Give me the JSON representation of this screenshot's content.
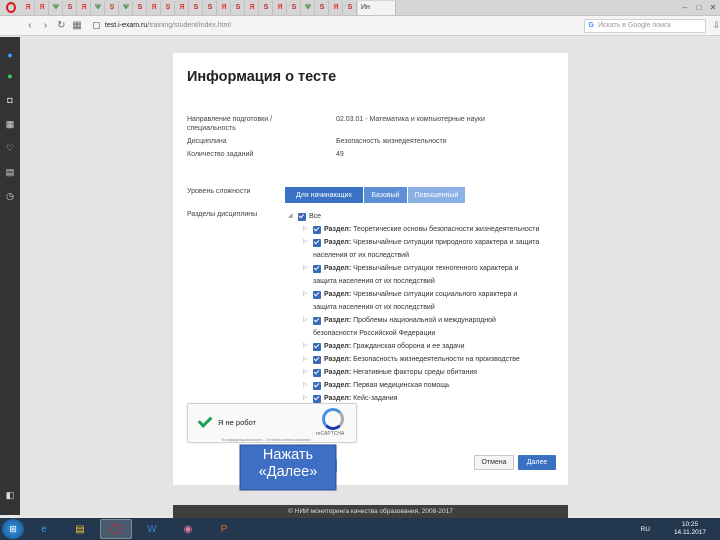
{
  "browser": {
    "tab_badges": [
      "Я",
      "Я",
      "Ψ",
      "S",
      "Я",
      "Ψ",
      "S",
      "Ψ",
      "S",
      "Я",
      "S",
      "Я",
      "S",
      "S",
      "Я",
      "S",
      "Я",
      "S",
      "Я",
      "S",
      "Ψ",
      "S",
      "Я",
      "S"
    ],
    "active_tab": "Ин",
    "url_host": "test.i-exam.ru",
    "url_path": "/training/student/index.html",
    "search_placeholder": "Искать в Google поиск"
  },
  "page": {
    "title": "Информация о тесте",
    "info_rows": [
      {
        "label": "Направление подготовки / специальность",
        "value": "02.03.01 - Математика и компьютерные науки"
      },
      {
        "label": "Дисциплина",
        "value": "Безопасность жизнедеятельности"
      },
      {
        "label": "Количество заданий",
        "value": "49"
      }
    ],
    "difficulty_label": "Уровень сложности",
    "difficulty_options": [
      "Для начинающих",
      "Базовый",
      "Повышенный"
    ],
    "sections_label": "Разделы дисциплины",
    "tree_root": "Все",
    "section_prefix": "Раздел:",
    "sections": [
      "Теоретические основы безопасности жизнедеятельности",
      "Чрезвычайные ситуации природного характера и защита",
      "населения от их последствий",
      "Чрезвычайные ситуации техногенного характера и",
      "защита населения от их последствий",
      "Чрезвычайные ситуации социального характера и",
      "защита населения от их последствий",
      "Проблемы национальной и международной",
      "безопасности Российской Федерации",
      "Гражданская оборона и ее задачи",
      "Безопасность жизнедеятельности на производстве",
      "Негативные факторы среды обитания",
      "Первая медицинская помощь",
      "Кейс-задания"
    ],
    "captcha_text": "Я не робот",
    "captcha_brand": "reCAPTCHA",
    "captcha_terms": "Конфиденциальность - Условия использования",
    "cancel_label": "Отмена",
    "next_label": "Далее",
    "callout_line1": "Нажать",
    "callout_line2": "«Далее»",
    "footer": "© НИИ мониторинга качества образования, 2008-2017"
  },
  "taskbar": {
    "lang": "RU",
    "time": "10:25",
    "date": "14.11.2017"
  },
  "colors": {
    "primary_button": "#3a72c3",
    "checkbox": "#3a6bb5",
    "callout_fill": "#3f6fc4",
    "opera_red": "#e0171f"
  }
}
